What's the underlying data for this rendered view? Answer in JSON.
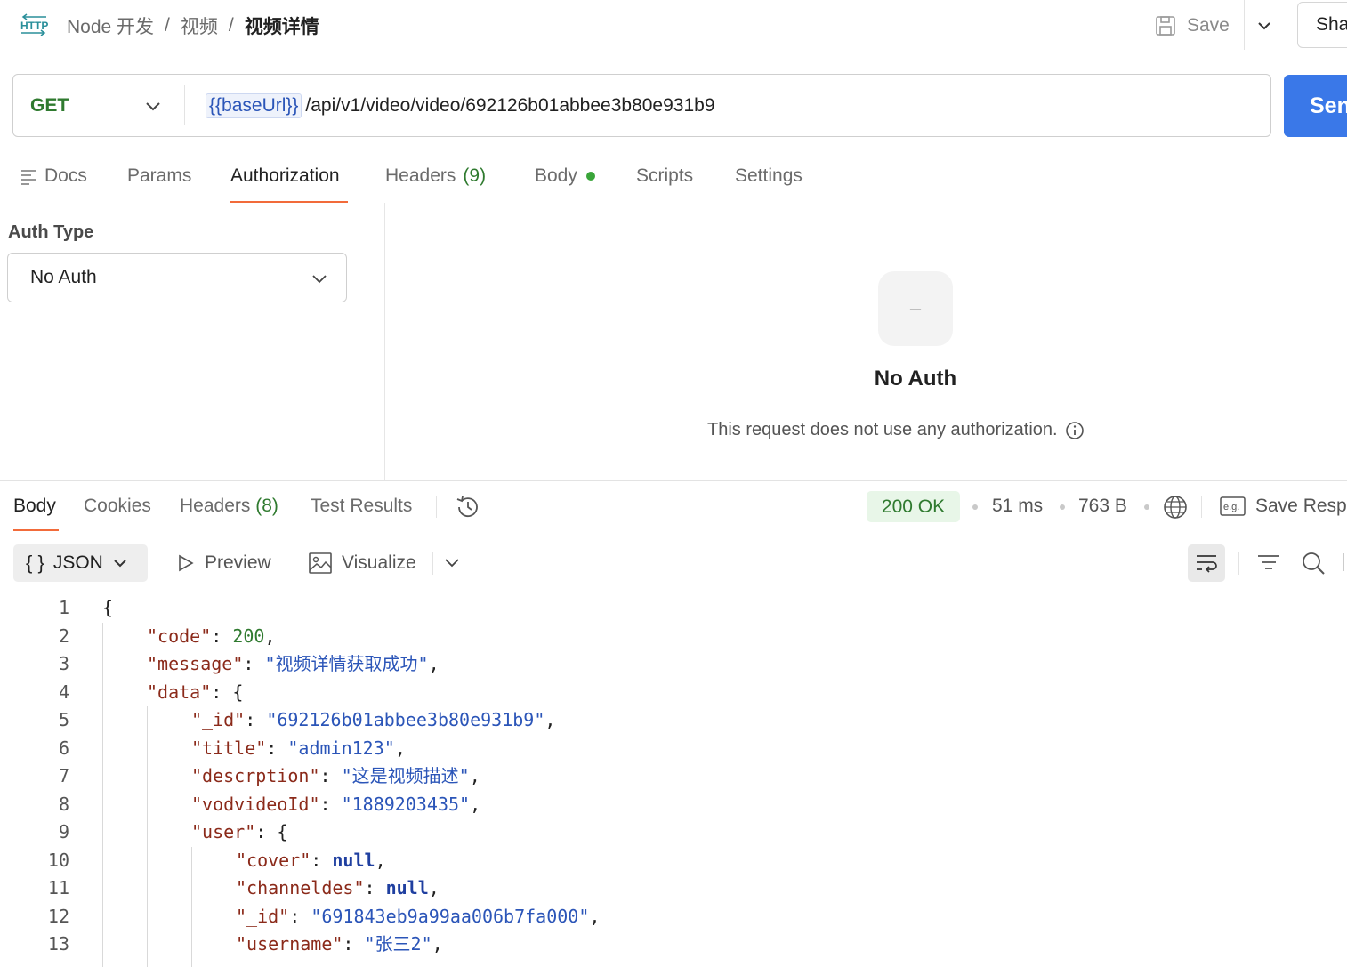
{
  "header": {
    "breadcrumb": [
      "Node 开发",
      "视频",
      "视频详情"
    ],
    "save_label": "Save",
    "share_label": "Sha"
  },
  "request": {
    "method": "GET",
    "url_var": "{{baseUrl}}",
    "url_path": "/api/v1/video/video/692126b01abbee3b80e931b9",
    "send_label": "Sen"
  },
  "request_tabs": [
    {
      "label": "Docs"
    },
    {
      "label": "Params"
    },
    {
      "label": "Authorization"
    },
    {
      "label": "Headers",
      "count": "(9)"
    },
    {
      "label": "Body"
    },
    {
      "label": "Scripts"
    },
    {
      "label": "Settings"
    }
  ],
  "auth": {
    "type_label": "Auth Type",
    "selected": "No Auth",
    "placeholder_icon": "–",
    "title": "No Auth",
    "description": "This request does not use any authorization."
  },
  "response": {
    "tabs": [
      {
        "label": "Body"
      },
      {
        "label": "Cookies"
      },
      {
        "label": "Headers",
        "count": "(8)"
      },
      {
        "label": "Test Results"
      }
    ],
    "status": "200 OK",
    "time": "51 ms",
    "size": "763 B",
    "save_label": "Save Resp",
    "format": "JSON",
    "preview_label": "Preview",
    "visualize_label": "Visualize"
  },
  "code_lines": [
    {
      "n": "1",
      "t": "{"
    },
    {
      "n": "2",
      "k": "\"code\"",
      "v": "200",
      "vt": "n",
      "c": ","
    },
    {
      "n": "3",
      "k": "\"message\"",
      "v": "\"视频详情获取成功\"",
      "vt": "s",
      "c": ","
    },
    {
      "n": "4",
      "k": "\"data\"",
      "v": "{",
      "vt": "p",
      "c": ""
    },
    {
      "n": "5",
      "k": "\"_id\"",
      "v": "\"692126b01abbee3b80e931b9\"",
      "vt": "s",
      "c": ","
    },
    {
      "n": "6",
      "k": "\"title\"",
      "v": "\"admin123\"",
      "vt": "s",
      "c": ","
    },
    {
      "n": "7",
      "k": "\"descrption\"",
      "v": "\"这是视频描述\"",
      "vt": "s",
      "c": ","
    },
    {
      "n": "8",
      "k": "\"vodvideoId\"",
      "v": "\"1889203435\"",
      "vt": "s",
      "c": ","
    },
    {
      "n": "9",
      "k": "\"user\"",
      "v": "{",
      "vt": "p",
      "c": ""
    },
    {
      "n": "10",
      "k": "\"cover\"",
      "v": "null",
      "vt": "b",
      "c": ","
    },
    {
      "n": "11",
      "k": "\"channeldes\"",
      "v": "null",
      "vt": "b",
      "c": ","
    },
    {
      "n": "12",
      "k": "\"_id\"",
      "v": "\"691843eb9a99aa006b7fa000\"",
      "vt": "s",
      "c": ","
    },
    {
      "n": "13",
      "k": "\"username\"",
      "v": "\"张三2\"",
      "vt": "s",
      "c": ","
    }
  ],
  "icons": {
    "http": "http-icon",
    "save": "floppy-disk-icon",
    "dropdown": "chevron-down-icon",
    "docs": "lines-icon",
    "history": "history-icon",
    "globe": "globe-icon",
    "example": "eg-icon",
    "play": "play-icon",
    "image": "image-icon",
    "wrap": "wrap-lines-icon",
    "filter": "filter-icon",
    "search": "search-icon",
    "info": "info-icon"
  },
  "colors": {
    "accent_tab": "#f26b3a",
    "send_button": "#3a78e8",
    "method_get": "#2f7a2f",
    "json_key": "#8b2a1a",
    "json_string": "#2b55b8",
    "json_number": "#2f7a2f"
  }
}
